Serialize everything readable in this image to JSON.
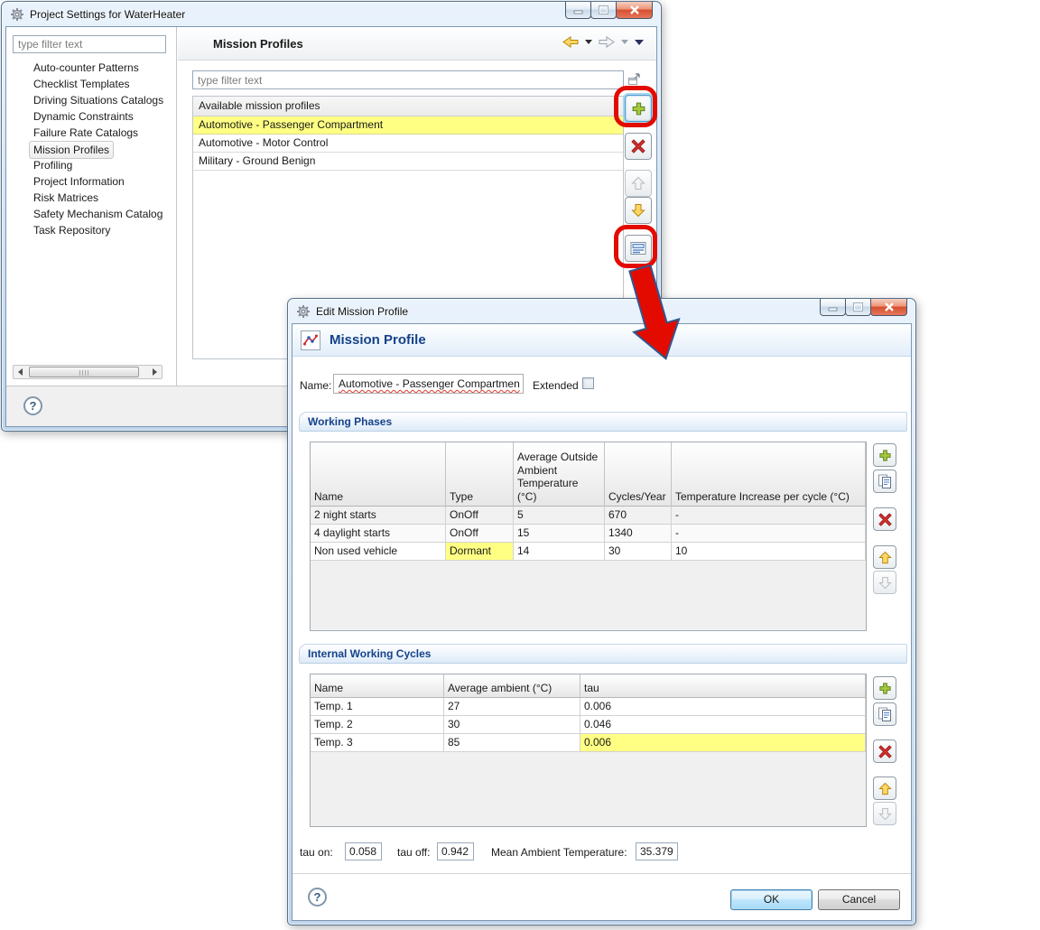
{
  "colors": {
    "accent_blue": "#15428b",
    "highlight_yellow": "#ffff84",
    "annotation_red": "#e30b00"
  },
  "window1": {
    "title": "Project Settings for WaterHeater",
    "sidebar_filter_value": "type filter text",
    "tree_items": [
      "Auto-counter Patterns",
      "Checklist Templates",
      "Driving Situations Catalogs",
      "Dynamic Constraints",
      "Failure Rate Catalogs",
      "Mission Profiles",
      "Profiling",
      "Project Information",
      "Risk Matrices",
      "Safety Mechanism Catalog",
      "Task Repository"
    ],
    "panel_title": "Mission Profiles",
    "list_filter_value": "type filter text",
    "list_header": "Available mission profiles",
    "profiles": [
      "Automotive - Passenger Compartment",
      "Automotive - Motor Control",
      "Military - Ground Benign"
    ]
  },
  "window2": {
    "title": "Edit Mission Profile",
    "header_title": "Mission Profile",
    "name_label": "Name:",
    "name_value": "Automotive - Passenger Compartmen",
    "extended_label": "Extended",
    "working_phases": {
      "title": "Working Phases",
      "columns": [
        "Name",
        "Type",
        "Average Outside Ambient Temperature (°C)",
        "Cycles/Year",
        "Temperature Increase per cycle (°C)"
      ],
      "rows": [
        [
          "2 night starts",
          "OnOff",
          "5",
          "670",
          "-"
        ],
        [
          "4 daylight starts",
          "OnOff",
          "15",
          "1340",
          "-"
        ],
        [
          "Non used vehicle",
          "Dormant",
          "14",
          "30",
          "10"
        ]
      ]
    },
    "internal_cycles": {
      "title": "Internal Working Cycles",
      "columns": [
        "Name",
        "Average ambient (°C)",
        "tau"
      ],
      "rows": [
        [
          "Temp. 1",
          "27",
          "0.006"
        ],
        [
          "Temp. 2",
          "30",
          "0.046"
        ],
        [
          "Temp. 3",
          "85",
          "0.006"
        ]
      ]
    },
    "tau_on_label": "tau on:",
    "tau_on_value": "0.058",
    "tau_off_label": "tau off:",
    "tau_off_value": "0.942",
    "mean_temp_label": "Mean Ambient Temperature:",
    "mean_temp_value": "35.379",
    "ok_label": "OK",
    "cancel_label": "Cancel"
  }
}
